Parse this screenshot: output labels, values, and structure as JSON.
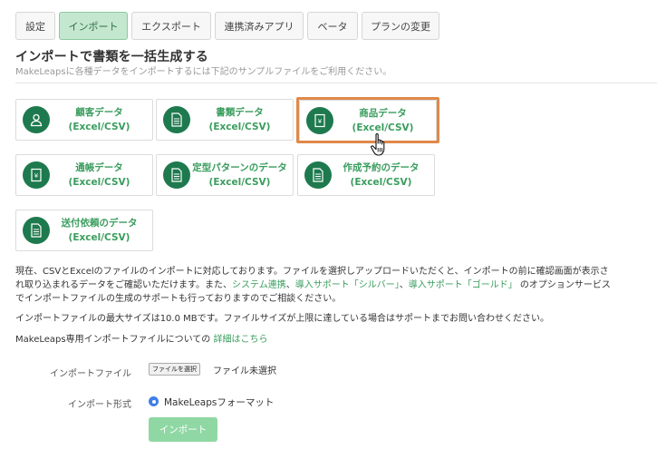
{
  "tabs": [
    {
      "label": "設定",
      "active": false
    },
    {
      "label": "インポート",
      "active": true
    },
    {
      "label": "エクスポート",
      "active": false
    },
    {
      "label": "連携済みアプリ",
      "active": false
    },
    {
      "label": "ベータ",
      "active": false
    },
    {
      "label": "プランの変更",
      "active": false
    }
  ],
  "heading": "インポートで書類を一括生成する",
  "subheading": "MakeLeapsに各種データをインポートするには下記のサンプルファイルをご利用ください。",
  "cards": [
    {
      "line1": "顧客データ",
      "line2": "(Excel/CSV)",
      "icon": "person-icon"
    },
    {
      "line1": "書類データ",
      "line2": "(Excel/CSV)",
      "icon": "document-icon"
    },
    {
      "line1": "商品データ",
      "line2": "(Excel/CSV)",
      "icon": "yen-book-icon"
    },
    {
      "line1": "通帳データ",
      "line2": "(Excel/CSV)",
      "icon": "yen-book-icon"
    },
    {
      "line1": "定型パターンのデータ",
      "line2": "(Excel/CSV)",
      "icon": "document-icon"
    },
    {
      "line1": "作成予約のデータ",
      "line2": "(Excel/CSV)",
      "icon": "document-icon"
    },
    {
      "line1": "送付依頼のデータ",
      "line2": "(Excel/CSV)",
      "icon": "document-icon"
    }
  ],
  "info": {
    "p1_line1": "現在、CSVとExcelのファイルのインポートに対応しております。ファイルを選択しアップロードいただくと、インポートの前に確認画面が表示さ",
    "p1_line2_a": "れ取り込まれるデータをご確認いただけます。また、",
    "p1_link1": "システム連携",
    "p1_sep1": "、",
    "p1_link2": "導入サポート「シルバー」",
    "p1_sep2": "、",
    "p1_link3": "導入サポート「ゴールド」",
    "p1_line2_b": " のオプションサービス",
    "p1_line3": "でインポートファイルの生成のサポートも行っておりますのでご相談ください。",
    "p2": "インポートファイルの最大サイズは10.0 MBです。ファイルサイズが上限に達している場合はサポートまでお問い合わせください。",
    "p3_text": "MakeLeaps専用インポートファイルについての ",
    "p3_link": "詳細はこちら"
  },
  "form": {
    "file_label": "インポートファイル",
    "file_button": "ファイルを選択",
    "file_status": "ファイル未選択",
    "format_label": "インポート形式",
    "format_option": "MakeLeapsフォーマット",
    "submit": "インポート"
  },
  "colors": {
    "accent": "#3a9d5e",
    "icon_bg": "#1e7a4e",
    "highlight": "#e0894b",
    "button": "#8fd8a4"
  }
}
